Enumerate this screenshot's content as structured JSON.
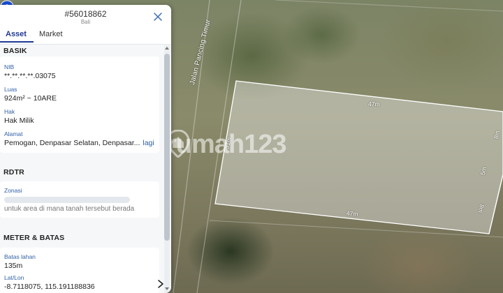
{
  "header": {
    "listing_id": "#56018862",
    "location": "Bali",
    "tabs": [
      {
        "label": "Asset",
        "active": true
      },
      {
        "label": "Market",
        "active": false
      }
    ]
  },
  "sections": {
    "basik": {
      "title": "BASIK",
      "nib_label": "NIB",
      "nib_value": "**.**.**.**.03075",
      "luas_label": "Luas",
      "luas_value": "924m² ~ 10ARE",
      "hak_label": "Hak",
      "hak_value": "Hak Milik",
      "alamat_label": "Alamat",
      "alamat_value": "Pemogan, Denpasar Selatan, Denpasar...",
      "alamat_more": "lagi"
    },
    "rdtr": {
      "title": "RDTR",
      "zonasi_label": "Zonasi",
      "zonasi_hint": "untuk area di mana tanah tersebut berada"
    },
    "meter": {
      "title": "METER & BATAS",
      "batas_label": "Batas lahan",
      "batas_value": "135m",
      "latlon_label": "Lat/Lon",
      "latlon_value": "-8.7118075, 115.191188836"
    }
  },
  "map": {
    "street_name": "Jalan Pancing Timur",
    "dimensions": {
      "top": "47m",
      "bottom": "47m",
      "left": "31m",
      "right_upper": "8m",
      "right_middle": "5m",
      "right_lower": "8m"
    },
    "watermark": "rumah123"
  },
  "colors": {
    "accent": "#1f3a93",
    "label": "#2f5fa7",
    "pin": "#1a4fd6"
  }
}
